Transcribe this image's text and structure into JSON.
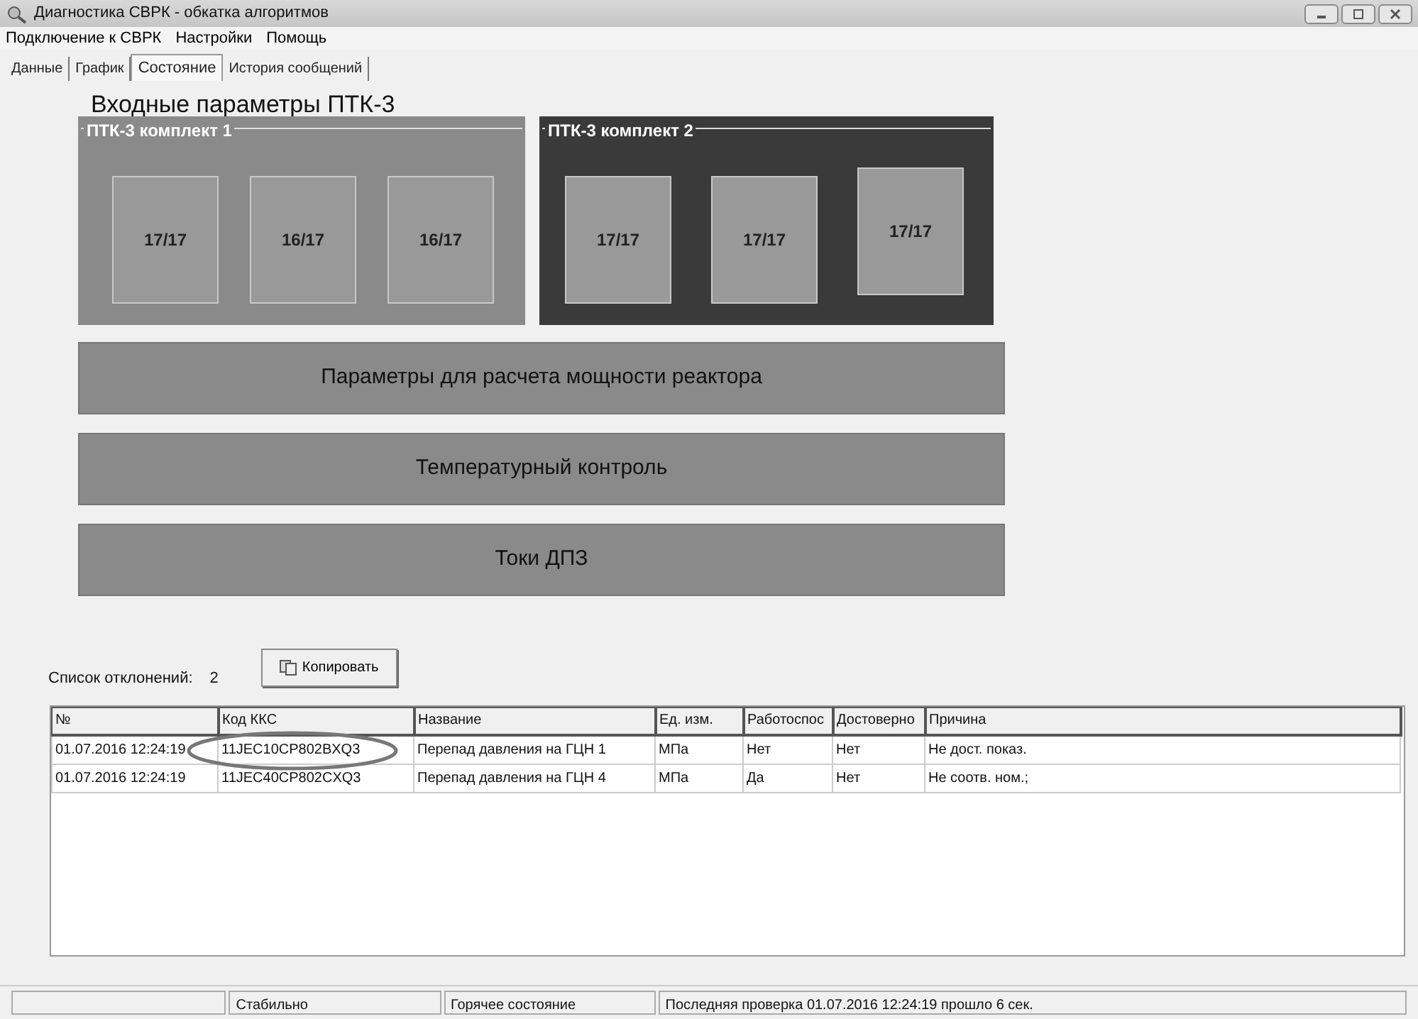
{
  "window": {
    "title": "Диагностика СВРК - обкатка алгоритмов"
  },
  "menu": [
    "Подключение к СВРК",
    "Настройки",
    "Помощь"
  ],
  "tabs": [
    {
      "label": "Данные",
      "selected": false
    },
    {
      "label": "График",
      "selected": false
    },
    {
      "label": "Состояние",
      "selected": true
    },
    {
      "label": "История сообщений",
      "selected": false
    }
  ],
  "heading": "Входные параметры ПТК-3",
  "groups": [
    {
      "title": "ПТК-3 комплект 1",
      "kind": "light",
      "tiles": [
        "17/17",
        "16/17",
        "16/17"
      ]
    },
    {
      "title": "ПТК-3 комплект 2",
      "kind": "dark",
      "tiles": [
        "17/17",
        "17/17",
        "17/17"
      ]
    }
  ],
  "sections": [
    "Параметры для расчета мощности реактора",
    "Температурный контроль",
    "Токи ДПЗ"
  ],
  "deviations": {
    "label": "Список отклонений:",
    "count": "2",
    "copy_button": "Копировать"
  },
  "table": {
    "columns": [
      "№",
      "Код ККС",
      "Название",
      "Ед. изм.",
      "Работоспос",
      "Достоверно",
      "Причина"
    ],
    "rows": [
      [
        "01.07.2016 12:24:19",
        "11JEC10CP802BXQ3",
        "Перепад давления на ГЦН 1",
        "МПа",
        "Нет",
        "Нет",
        "Не дост. показ."
      ],
      [
        "01.07.2016 12:24:19",
        "11JEC40CP802CXQ3",
        "Перепад давления на ГЦН 4",
        "МПа",
        "Да",
        "Нет",
        "Не соотв. ном.;"
      ]
    ],
    "highlight": {
      "kind": "ellipse"
    }
  },
  "status_bar": [
    "Стабильно",
    "Горячее состояние",
    "Последняя проверка 01.07.2016 12:24:19 прошло 6 сек."
  ]
}
